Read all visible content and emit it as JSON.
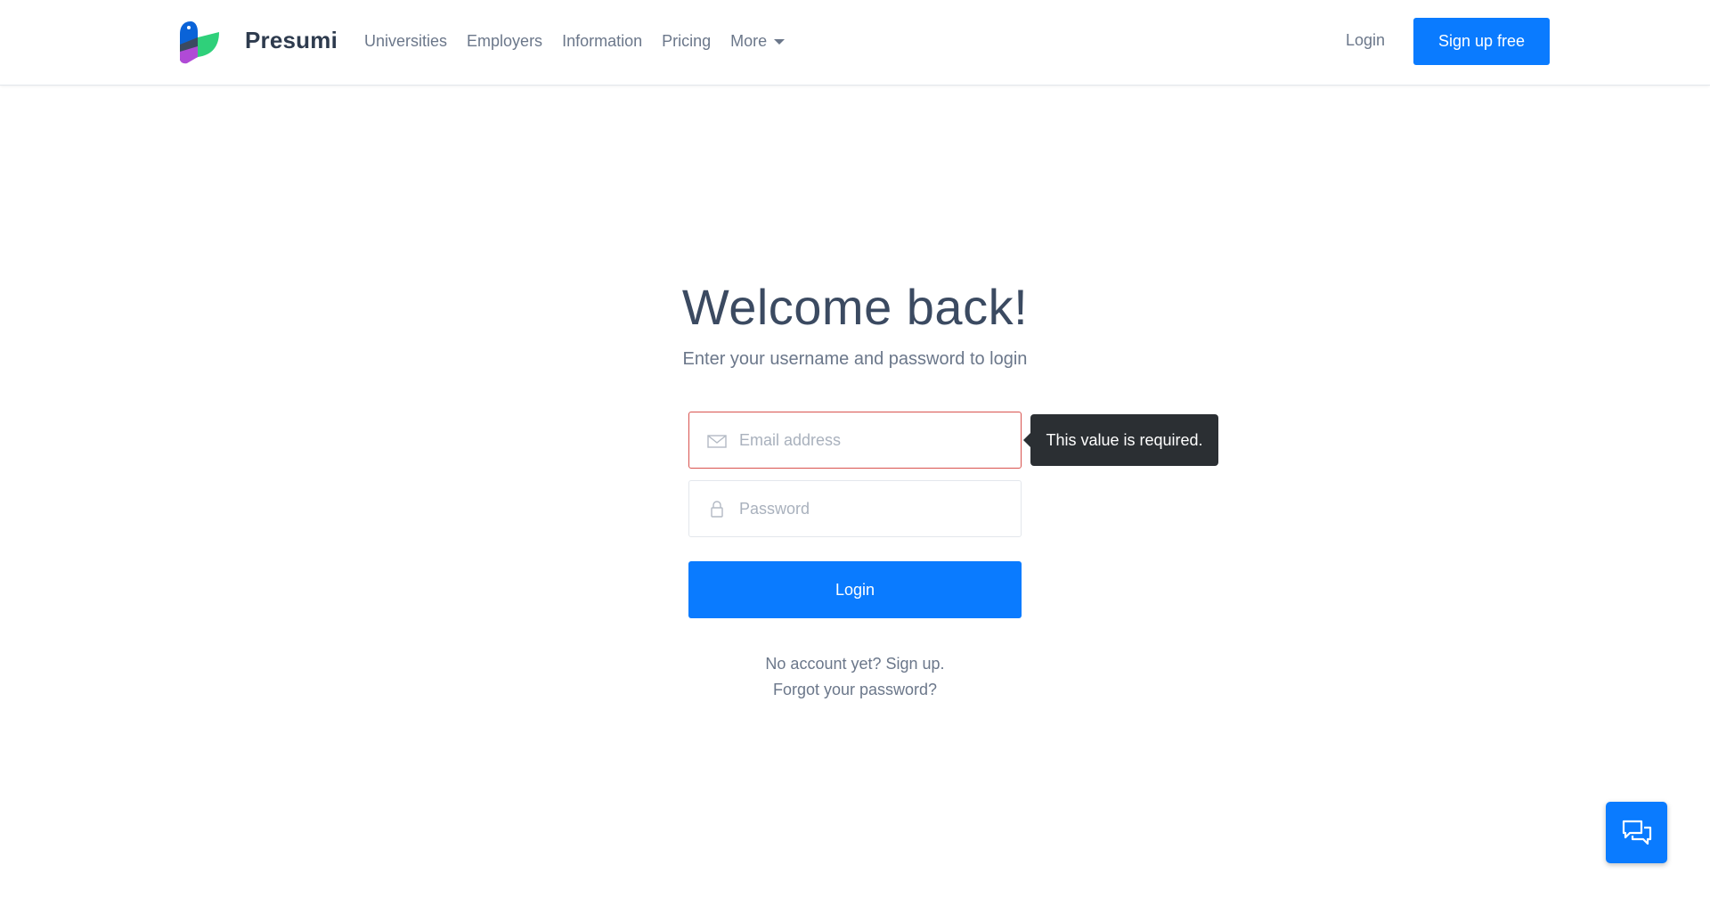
{
  "header": {
    "brand": "Presumi",
    "nav": [
      {
        "label": "Universities"
      },
      {
        "label": "Employers"
      },
      {
        "label": "Information"
      },
      {
        "label": "Pricing"
      },
      {
        "label": "More"
      }
    ],
    "login_label": "Login",
    "signup_label": "Sign up free"
  },
  "main": {
    "title": "Welcome back!",
    "subtitle": "Enter your username and password to login",
    "email_placeholder": "Email address",
    "password_placeholder": "Password",
    "email_error": "This value is required.",
    "login_label": "Login",
    "signup_link": "No account yet? Sign up.",
    "forgot_link": "Forgot your password?"
  },
  "icons": {
    "email": "envelope-icon",
    "password": "lock-icon",
    "chat": "chat-icon",
    "more": "chevron-down-icon"
  },
  "colors": {
    "accent": "#0a7bff",
    "error_border": "#d9534f",
    "tooltip_bg": "#2b2f33"
  }
}
